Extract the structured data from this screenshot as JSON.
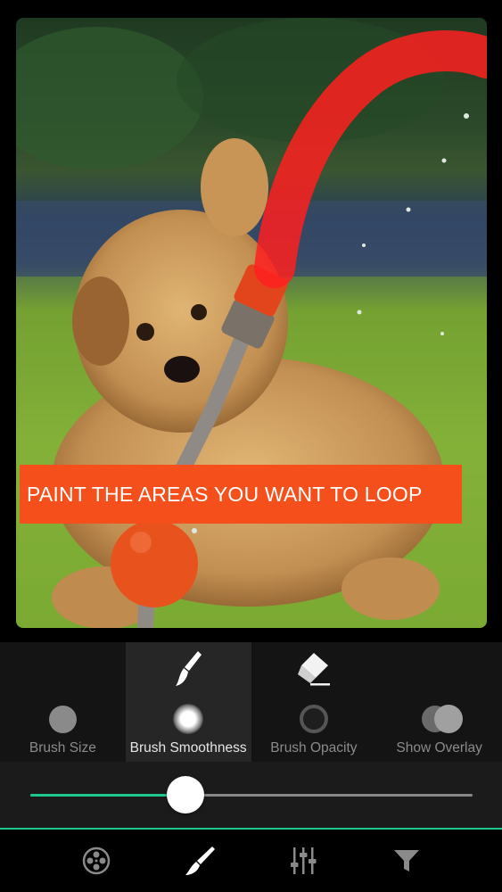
{
  "banner": {
    "text": "PAINT THE AREAS YOU WANT TO LOOP"
  },
  "tools": [
    {
      "label": "Brush Size",
      "active": false
    },
    {
      "label": "Brush Smoothness",
      "active": true
    },
    {
      "label": "Brush Opacity",
      "active": false
    },
    {
      "label": "Show Overlay",
      "active": false
    }
  ],
  "top_icons": {
    "brush": "paintbrush-icon",
    "eraser": "eraser-icon"
  },
  "slider": {
    "value": 0.35
  },
  "bottom_nav": [
    {
      "icon": "film-reel-icon",
      "active": false
    },
    {
      "icon": "brush-icon",
      "active": true
    },
    {
      "icon": "adjust-sliders-icon",
      "active": false
    },
    {
      "icon": "funnel-filter-icon",
      "active": false
    }
  ],
  "colors": {
    "accent": "#1ec88c",
    "banner": "#f5501b",
    "paint_overlay": "#ff2020"
  }
}
